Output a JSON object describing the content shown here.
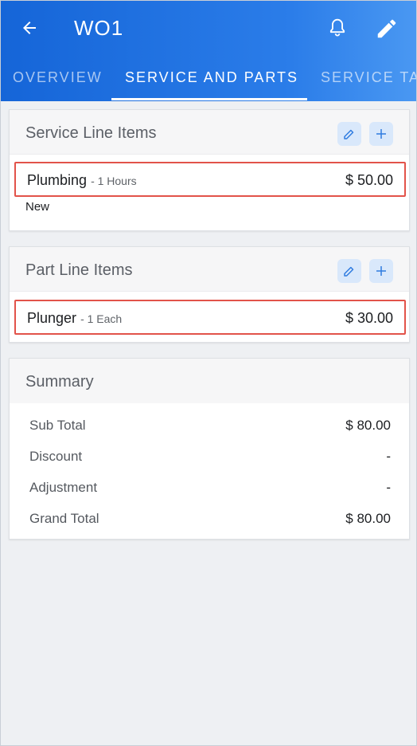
{
  "header": {
    "title": "WO1",
    "back_icon": "arrow-left-icon",
    "notification_icon": "bell-icon",
    "edit_icon": "pencil-icon"
  },
  "tabs": [
    {
      "label": "OVERVIEW",
      "active": false
    },
    {
      "label": "SERVICE AND PARTS",
      "active": true
    },
    {
      "label": "SERVICE TA",
      "active": false
    }
  ],
  "service_section": {
    "title": "Service Line Items",
    "items": [
      {
        "name": "Plumbing",
        "qty": "- 1 Hours",
        "price": "$ 50.00",
        "status": "New"
      }
    ]
  },
  "parts_section": {
    "title": "Part Line Items",
    "items": [
      {
        "name": "Plunger",
        "qty": "- 1 Each",
        "price": "$ 30.00"
      }
    ]
  },
  "summary": {
    "title": "Summary",
    "rows": [
      {
        "label": "Sub Total",
        "value": "$ 80.00"
      },
      {
        "label": "Discount",
        "value": "-"
      },
      {
        "label": "Adjustment",
        "value": "-"
      },
      {
        "label": "Grand Total",
        "value": "$ 80.00"
      }
    ]
  },
  "colors": {
    "primary": "#1565d8",
    "highlight_border": "#e2534a",
    "icon_button_bg": "#d9e8fb"
  }
}
